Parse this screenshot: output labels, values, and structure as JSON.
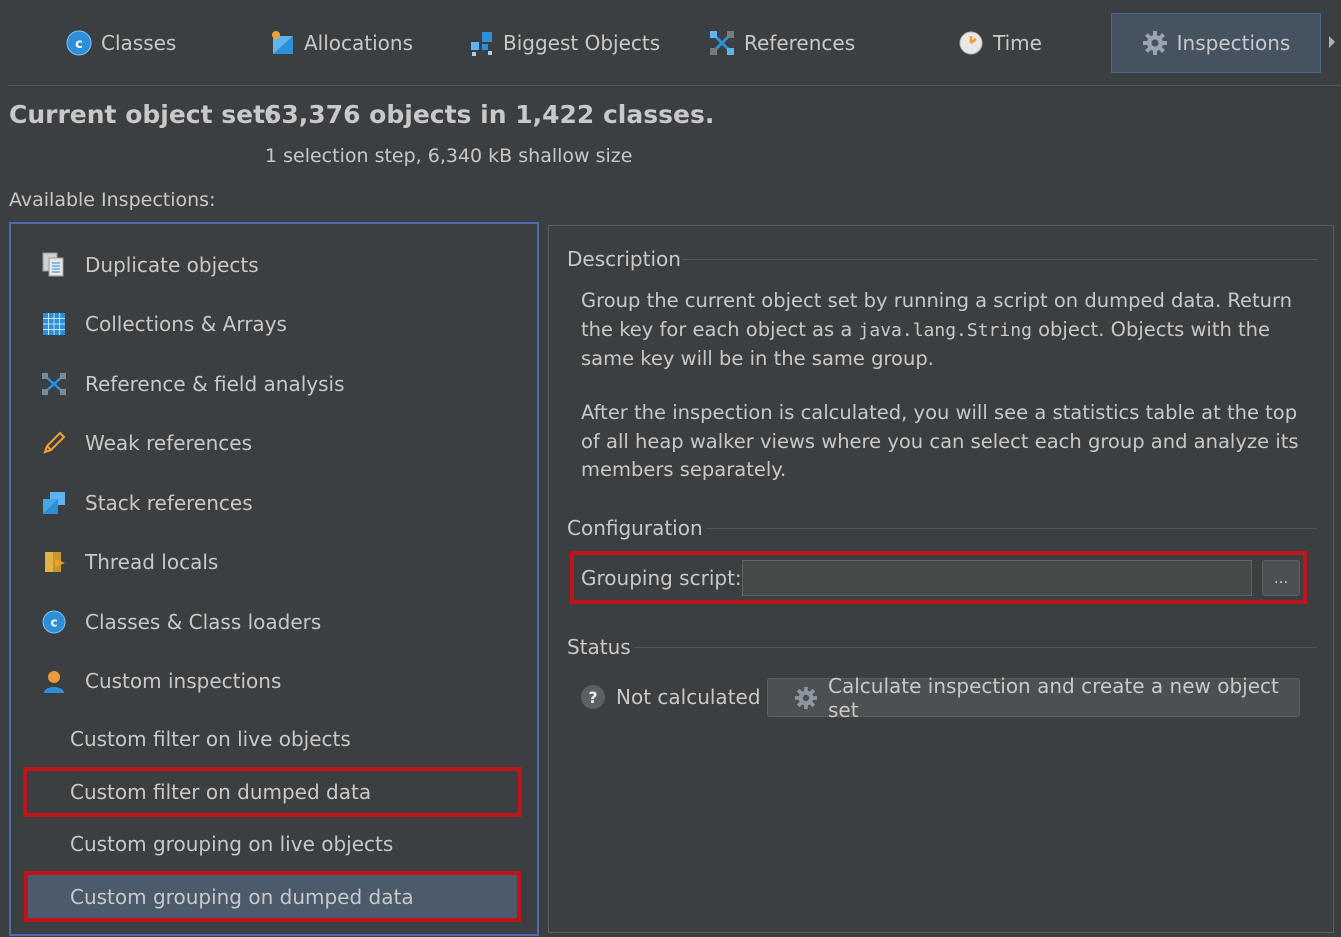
{
  "tabs": [
    {
      "label": "Classes",
      "icon": "classes-icon"
    },
    {
      "label": "Allocations",
      "icon": "allocations-icon"
    },
    {
      "label": "Biggest Objects",
      "icon": "biggest-objects-icon"
    },
    {
      "label": "References",
      "icon": "references-icon"
    },
    {
      "label": "Time",
      "icon": "time-icon"
    },
    {
      "label": "Inspections",
      "icon": "gear-icon",
      "active": true
    }
  ],
  "header": {
    "current_label": "Current object set:",
    "current_value": "63,376 objects in 1,422 classes.",
    "sub": "1 selection step, 6,340 kB shallow size",
    "available_label": "Available Inspections:"
  },
  "inspections": {
    "items": [
      {
        "label": "Duplicate objects",
        "icon": "duplicate-objects-icon"
      },
      {
        "label": "Collections & Arrays",
        "icon": "collections-arrays-icon"
      },
      {
        "label": "Reference & field analysis",
        "icon": "reference-field-icon"
      },
      {
        "label": "Weak references",
        "icon": "weak-references-icon"
      },
      {
        "label": "Stack references",
        "icon": "stack-references-icon"
      },
      {
        "label": "Thread locals",
        "icon": "thread-locals-icon"
      },
      {
        "label": "Classes & Class loaders",
        "icon": "class-loaders-icon"
      },
      {
        "label": "Custom inspections",
        "icon": "custom-inspections-icon"
      }
    ],
    "custom": [
      {
        "label": "Custom filter on live objects",
        "selected": false
      },
      {
        "label": "Custom filter on dumped data",
        "selected": false
      },
      {
        "label": "Custom grouping on live objects",
        "selected": false
      },
      {
        "label": "Custom grouping on dumped data",
        "selected": true
      }
    ]
  },
  "detail": {
    "description_title": "Description",
    "desc1_a": "Group the current object set by running a script on dumped data. Return the key for each object as a ",
    "desc1_code": "java.lang.String",
    "desc1_b": " object. Objects with the same key will be in the same group.",
    "desc2": "After the inspection is calculated, you will see a statistics table at the top of all heap walker views where you can select each group and analyze its members separately.",
    "configuration_title": "Configuration",
    "grouping_label": "Grouping script:",
    "grouping_value": "",
    "browse_label": "...",
    "status_title": "Status",
    "status_icon": "?",
    "status_text": "Not calculated",
    "calc_button": "Calculate inspection and create a new object set"
  },
  "colors": {
    "background": "#3c3f41",
    "highlight": "#c0141b",
    "focus_border": "#4b6eaf",
    "selected_row": "#4b5b6b"
  }
}
